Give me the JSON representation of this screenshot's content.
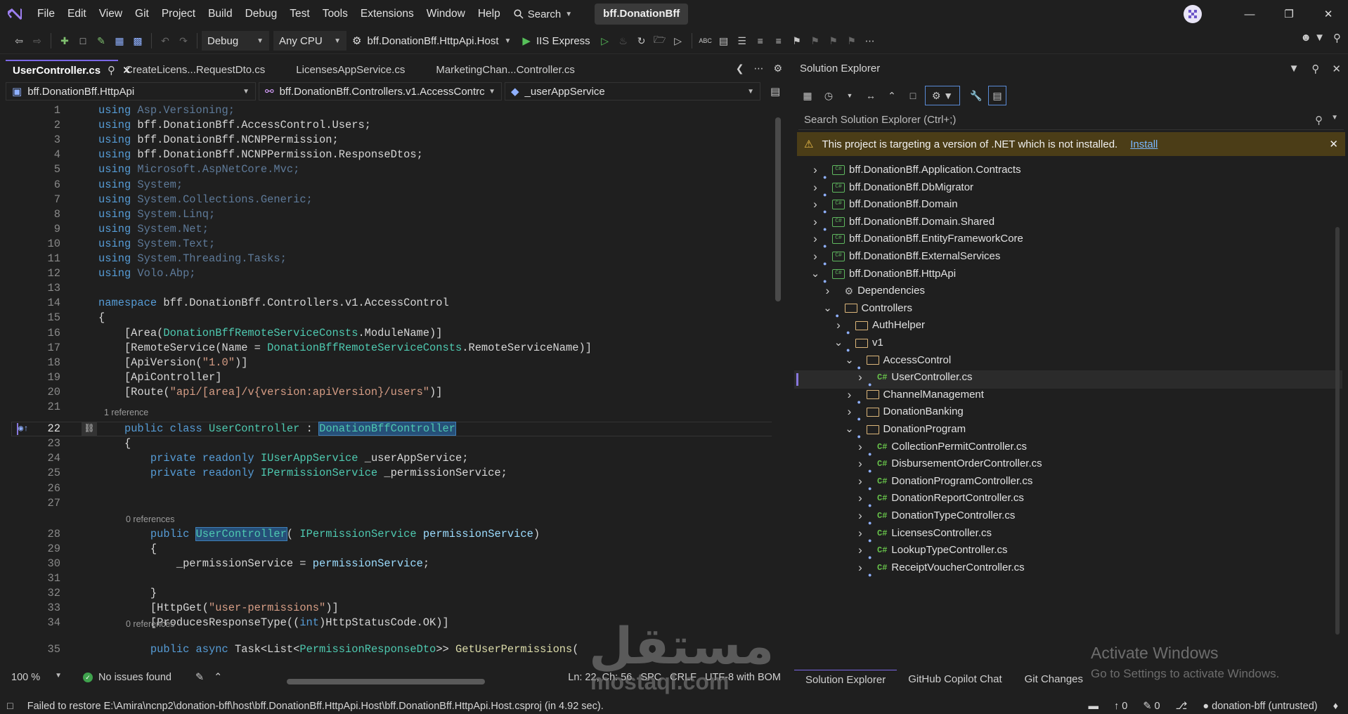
{
  "menu": [
    "File",
    "Edit",
    "View",
    "Git",
    "Project",
    "Build",
    "Debug",
    "Test",
    "Tools",
    "Extensions",
    "Window",
    "Help"
  ],
  "search_label": "Search",
  "solution_name": "bff.DonationBff",
  "toolbar": {
    "config": "Debug",
    "platform": "Any CPU",
    "startup_project": "bff.DonationBff.HttpApi.Host",
    "run_target": "IIS Express"
  },
  "tabs": [
    {
      "label": "UserController.cs",
      "active": true
    },
    {
      "label": "CreateLicens...RequestDto.cs"
    },
    {
      "label": "LicensesAppService.cs"
    },
    {
      "label": "MarketingChan...Controller.cs"
    }
  ],
  "navbar": {
    "project": "bff.DonationBff.HttpApi",
    "type": "bff.DonationBff.Controllers.v1.AccessContrc",
    "member": "_userAppService"
  },
  "code_lines": [
    {
      "n": "1",
      "segs": [
        [
          "kw",
          "using"
        ],
        [
          "usg",
          " Asp.Versioning;"
        ]
      ]
    },
    {
      "n": "2",
      "segs": [
        [
          "kw",
          "using"
        ],
        [
          "nm",
          " bff.DonationBff.AccessControl.Users;"
        ]
      ]
    },
    {
      "n": "3",
      "segs": [
        [
          "kw",
          "using"
        ],
        [
          "nm",
          " bff.DonationBff.NCNPPermission;"
        ]
      ]
    },
    {
      "n": "4",
      "segs": [
        [
          "kw",
          "using"
        ],
        [
          "nm",
          " bff.DonationBff.NCNPPermission.ResponseDtos;"
        ]
      ]
    },
    {
      "n": "5",
      "segs": [
        [
          "kw",
          "using"
        ],
        [
          "usg",
          " Microsoft.AspNetCore.Mvc;"
        ]
      ]
    },
    {
      "n": "6",
      "segs": [
        [
          "kw",
          "using"
        ],
        [
          "usg",
          " System;"
        ]
      ]
    },
    {
      "n": "7",
      "segs": [
        [
          "kw",
          "using"
        ],
        [
          "usg",
          " System.Collections.Generic;"
        ]
      ]
    },
    {
      "n": "8",
      "segs": [
        [
          "kw",
          "using"
        ],
        [
          "usg",
          " System.Linq;"
        ]
      ]
    },
    {
      "n": "9",
      "segs": [
        [
          "kw",
          "using"
        ],
        [
          "usg",
          " System.Net;"
        ]
      ]
    },
    {
      "n": "10",
      "segs": [
        [
          "kw",
          "using"
        ],
        [
          "usg",
          " System.Text;"
        ]
      ]
    },
    {
      "n": "11",
      "segs": [
        [
          "kw",
          "using"
        ],
        [
          "usg",
          " System.Threading.Tasks;"
        ]
      ]
    },
    {
      "n": "12",
      "segs": [
        [
          "kw",
          "using"
        ],
        [
          "usg",
          " Volo.Abp;"
        ]
      ]
    },
    {
      "n": "13",
      "segs": []
    },
    {
      "n": "14",
      "segs": [
        [
          "kw",
          "namespace"
        ],
        [
          "nm",
          " bff.DonationBff.Controllers.v1.AccessControl"
        ]
      ]
    },
    {
      "n": "15",
      "segs": [
        [
          "nm",
          "{"
        ]
      ]
    },
    {
      "n": "16",
      "segs": [
        [
          "nm",
          "    [Area("
        ],
        [
          "ty",
          "DonationBffRemoteServiceConsts"
        ],
        [
          "nm",
          ".ModuleName)]"
        ]
      ]
    },
    {
      "n": "17",
      "segs": [
        [
          "nm",
          "    [RemoteService(Name = "
        ],
        [
          "ty",
          "DonationBffRemoteServiceConsts"
        ],
        [
          "nm",
          ".RemoteServiceName)]"
        ]
      ]
    },
    {
      "n": "18",
      "segs": [
        [
          "nm",
          "    [ApiVersion("
        ],
        [
          "st",
          "\"1.0\""
        ],
        [
          "nm",
          ")]"
        ]
      ]
    },
    {
      "n": "19",
      "segs": [
        [
          "nm",
          "    [ApiController]"
        ]
      ]
    },
    {
      "n": "20",
      "segs": [
        [
          "nm",
          "    [Route("
        ],
        [
          "st",
          "\"api/[area]/v{version:apiVersion}/users\""
        ],
        [
          "nm",
          ")]"
        ]
      ]
    },
    {
      "n": "21",
      "segs": []
    },
    {
      "n": "22",
      "segs": [
        [
          "nm",
          "    "
        ],
        [
          "kw",
          "public class"
        ],
        [
          "nm",
          " "
        ],
        [
          "ty",
          "UserController"
        ],
        [
          "nm",
          " : "
        ],
        [
          "ty hl",
          "DonationBffController"
        ]
      ]
    },
    {
      "n": "23",
      "segs": [
        [
          "nm",
          "    {"
        ]
      ]
    },
    {
      "n": "24",
      "segs": [
        [
          "nm",
          "        "
        ],
        [
          "kw",
          "private readonly"
        ],
        [
          "nm",
          " "
        ],
        [
          "ty",
          "IUserAppService"
        ],
        [
          "nm",
          " _userAppService;"
        ]
      ]
    },
    {
      "n": "25",
      "segs": [
        [
          "nm",
          "        "
        ],
        [
          "kw",
          "private readonly"
        ],
        [
          "nm",
          " "
        ],
        [
          "ty",
          "IPermissionService"
        ],
        [
          "nm",
          " _permissionService;"
        ]
      ]
    },
    {
      "n": "26",
      "segs": []
    },
    {
      "n": "27",
      "segs": []
    },
    {
      "n": "28",
      "segs": [
        [
          "nm",
          "        "
        ],
        [
          "kw",
          "public"
        ],
        [
          "nm",
          " "
        ],
        [
          "ty hl",
          "UserController"
        ],
        [
          "nm",
          "( "
        ],
        [
          "ty",
          "IPermissionService"
        ],
        [
          "nm",
          " "
        ],
        [
          "id",
          "permissionService"
        ],
        [
          "nm",
          ")"
        ]
      ]
    },
    {
      "n": "29",
      "segs": [
        [
          "nm",
          "        {"
        ]
      ]
    },
    {
      "n": "30",
      "segs": [
        [
          "nm",
          "            _permissionService = "
        ],
        [
          "id",
          "permissionService"
        ],
        [
          "nm",
          ";"
        ]
      ]
    },
    {
      "n": "31",
      "segs": []
    },
    {
      "n": "32",
      "segs": [
        [
          "nm",
          "        }"
        ]
      ]
    },
    {
      "n": "33",
      "segs": [
        [
          "nm",
          "        [HttpGet("
        ],
        [
          "st",
          "\"user-permissions\""
        ],
        [
          "nm",
          ")]"
        ]
      ]
    },
    {
      "n": "34",
      "segs": [
        [
          "nm",
          "        [ProducesResponseType(("
        ],
        [
          "kw",
          "int"
        ],
        [
          "nm",
          ")HttpStatusCode.OK)]"
        ]
      ]
    },
    {
      "n": "35",
      "segs": [
        [
          "nm",
          "        "
        ],
        [
          "kw",
          "public async"
        ],
        [
          "nm",
          " Task<List<"
        ],
        [
          "ty",
          "PermissionResponseDto"
        ],
        [
          "nm",
          ">> "
        ],
        [
          "fn",
          "GetUserPermissions"
        ],
        [
          "nm",
          "("
        ]
      ]
    }
  ],
  "references": {
    "class_refs": "1 reference",
    "ctor_refs": "0 references",
    "method_refs": "0 references"
  },
  "editor_status": {
    "zoom": "100 %",
    "issues": "No issues found",
    "position": "Ln: 22, Ch: 56",
    "indent": "SPC",
    "eol": "CRLF",
    "encoding": "UTF-8 with BOM"
  },
  "solution_explorer": {
    "title": "Solution Explorer",
    "search_placeholder": "Search Solution Explorer (Ctrl+;)",
    "warning": "This project is targeting a version of .NET which is not installed.",
    "warning_link": "Install",
    "tree": [
      {
        "label": "bff.DonationBff.Application.Contracts",
        "kind": "proj",
        "level": 0,
        "exp": "collapsed"
      },
      {
        "label": "bff.DonationBff.DbMigrator",
        "kind": "proj",
        "level": 0,
        "exp": "collapsed"
      },
      {
        "label": "bff.DonationBff.Domain",
        "kind": "proj",
        "level": 0,
        "exp": "collapsed"
      },
      {
        "label": "bff.DonationBff.Domain.Shared",
        "kind": "proj",
        "level": 0,
        "exp": "collapsed"
      },
      {
        "label": "bff.DonationBff.EntityFrameworkCore",
        "kind": "proj",
        "level": 0,
        "exp": "collapsed"
      },
      {
        "label": "bff.DonationBff.ExternalServices",
        "kind": "proj",
        "level": 0,
        "exp": "collapsed"
      },
      {
        "label": "bff.DonationBff.HttpApi",
        "kind": "proj",
        "level": 0,
        "exp": "expanded"
      },
      {
        "label": "Dependencies",
        "kind": "dep",
        "level": 1,
        "exp": "collapsed"
      },
      {
        "label": "Controllers",
        "kind": "folder",
        "level": 1,
        "exp": "expanded"
      },
      {
        "label": "AuthHelper",
        "kind": "folder",
        "level": 2,
        "exp": "collapsed"
      },
      {
        "label": "v1",
        "kind": "folder",
        "level": 2,
        "exp": "expanded"
      },
      {
        "label": "AccessControl",
        "kind": "folder",
        "level": 3,
        "exp": "expanded"
      },
      {
        "label": "UserController.cs",
        "kind": "cs",
        "level": 4,
        "exp": "collapsed",
        "selected": true
      },
      {
        "label": "ChannelManagement",
        "kind": "folder",
        "level": 3,
        "exp": "collapsed"
      },
      {
        "label": "DonationBanking",
        "kind": "folder",
        "level": 3,
        "exp": "collapsed"
      },
      {
        "label": "DonationProgram",
        "kind": "folder",
        "level": 3,
        "exp": "expanded"
      },
      {
        "label": "CollectionPermitController.cs",
        "kind": "cs",
        "level": 4,
        "exp": "collapsed"
      },
      {
        "label": "DisbursementOrderController.cs",
        "kind": "cs",
        "level": 4,
        "exp": "collapsed"
      },
      {
        "label": "DonationProgramController.cs",
        "kind": "cs",
        "level": 4,
        "exp": "collapsed"
      },
      {
        "label": "DonationReportController.cs",
        "kind": "cs",
        "level": 4,
        "exp": "collapsed"
      },
      {
        "label": "DonationTypeController.cs",
        "kind": "cs",
        "level": 4,
        "exp": "collapsed"
      },
      {
        "label": "LicensesController.cs",
        "kind": "cs",
        "level": 4,
        "exp": "collapsed"
      },
      {
        "label": "LookupTypeController.cs",
        "kind": "cs",
        "level": 4,
        "exp": "collapsed"
      },
      {
        "label": "ReceiptVoucherController.cs",
        "kind": "cs",
        "level": 4,
        "exp": "collapsed"
      }
    ],
    "bottom_tabs": [
      "Solution Explorer",
      "GitHub Copilot Chat",
      "Git Changes"
    ]
  },
  "activate": {
    "title": "Activate Windows",
    "subtitle": "Go to Settings to activate Windows."
  },
  "watermark": {
    "arabic": "مستقل",
    "latin": "mostaql.com"
  },
  "statusbar": {
    "message": "Failed to restore E:\\Amira\\ncnp2\\donation-bff\\host\\bff.DonationBff.HttpApi.Host\\bff.DonationBff.HttpApi.Host.csproj (in 4.92 sec).",
    "up_count": "0",
    "edit_count": "0",
    "repo": "donation-bff (untrusted)"
  },
  "colors": {
    "accent": "#7a68e6",
    "keyword": "#569cd6",
    "type": "#4ec9b0",
    "string": "#d69d85",
    "warning_bg": "#4b3d17"
  }
}
